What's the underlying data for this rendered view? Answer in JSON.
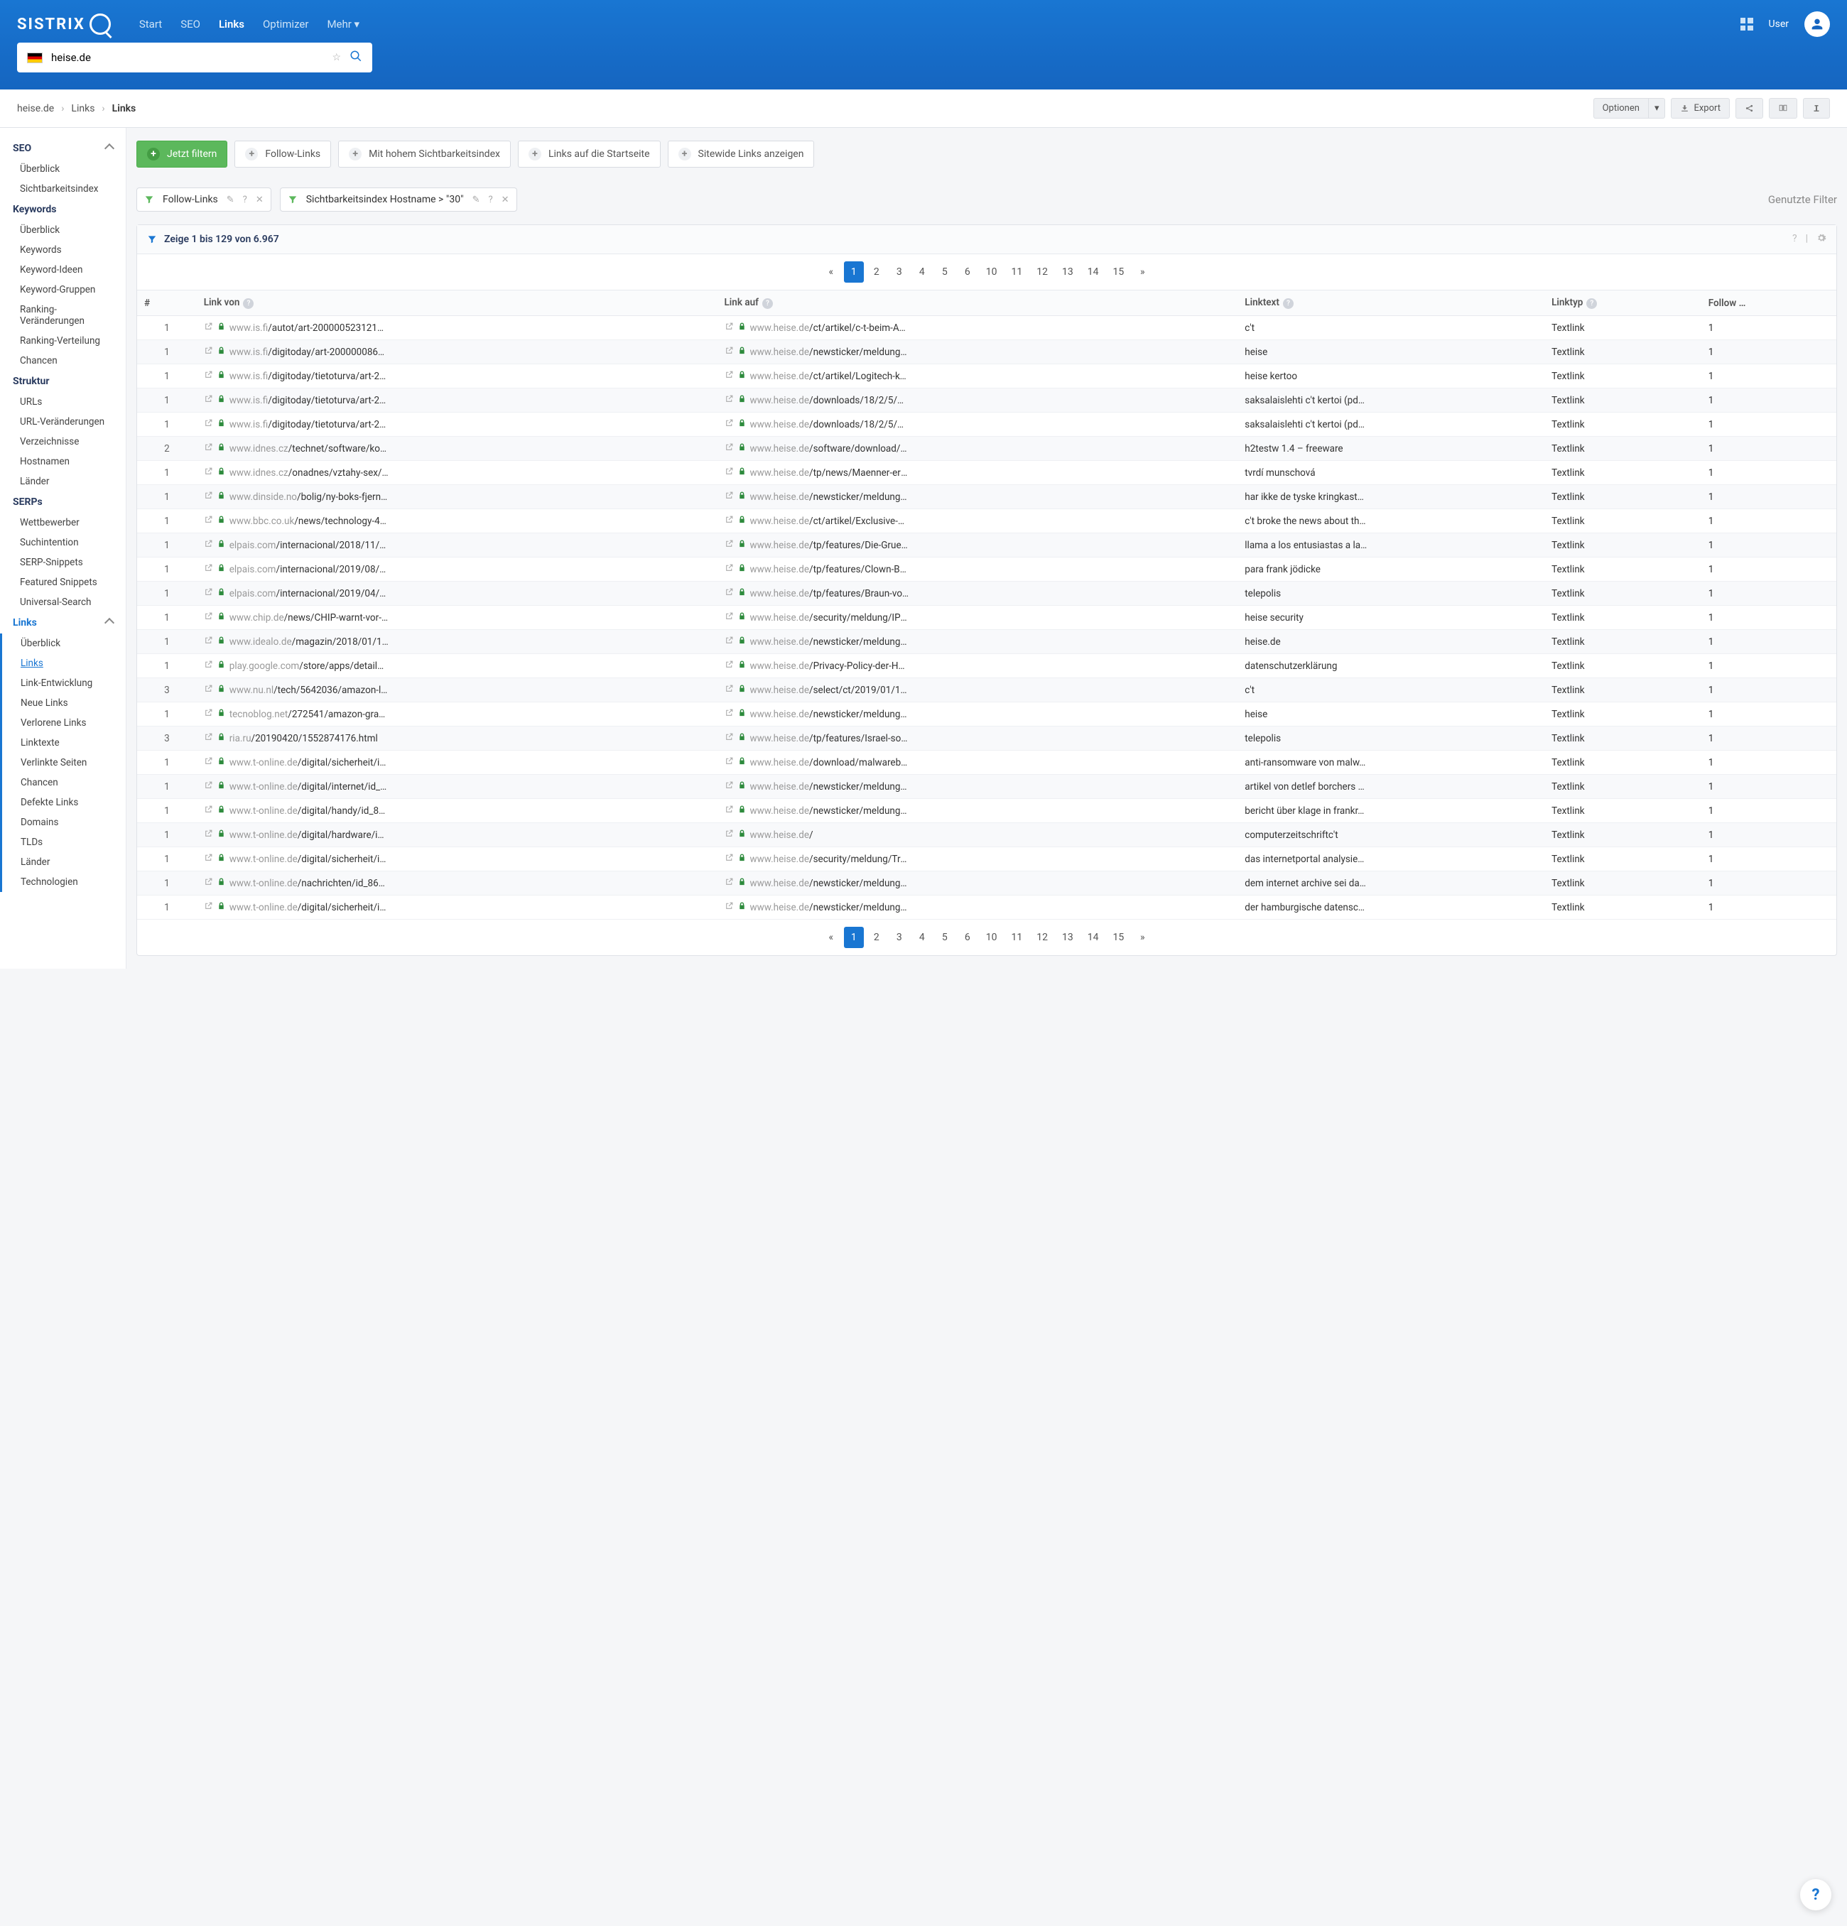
{
  "nav": {
    "brand": "SISTRIX",
    "links": [
      {
        "t": "Start"
      },
      {
        "t": "SEO"
      },
      {
        "t": "Links",
        "active": true
      },
      {
        "t": "Optimizer"
      },
      {
        "t": "Mehr ▾"
      }
    ],
    "user": "User"
  },
  "search": {
    "value": "heise.de"
  },
  "crumbs": [
    "heise.de",
    "Links",
    "Links"
  ],
  "toolbar": {
    "optionen": "Optionen",
    "export": "Export"
  },
  "side": {
    "seo": {
      "h": "SEO",
      "items": [
        "Überblick",
        "Sichtbarkeitsindex"
      ]
    },
    "keywords": {
      "h": "Keywords",
      "items": [
        "Überblick",
        "Keywords",
        "Keyword-Ideen",
        "Keyword-Gruppen",
        "Ranking-Veränderungen",
        "Ranking-Verteilung",
        "Chancen"
      ]
    },
    "struktur": {
      "h": "Struktur",
      "items": [
        "URLs",
        "URL-Veränderungen",
        "Verzeichnisse",
        "Hostnamen",
        "Länder"
      ]
    },
    "serps": {
      "h": "SERPs",
      "items": [
        "Wettbewerber",
        "Suchintention",
        "SERP-Snippets",
        "Featured Snippets",
        "Universal-Search"
      ]
    },
    "links": {
      "h": "Links",
      "items": [
        "Überblick",
        "Links",
        "Link-Entwicklung",
        "Neue Links",
        "Verlorene Links",
        "Linktexte",
        "Verlinkte Seiten",
        "Chancen",
        "Defekte Links",
        "Domains",
        "TLDs",
        "Länder",
        "Technologien"
      ],
      "active": 1
    }
  },
  "filters": {
    "btns": [
      {
        "t": "Jetzt filtern",
        "green": true
      },
      {
        "t": "Follow-Links"
      },
      {
        "t": "Mit hohem Sichtbarkeitsindex"
      },
      {
        "t": "Links auf die Startseite"
      },
      {
        "t": "Sitewide Links anzeigen"
      }
    ],
    "chips": [
      {
        "t": "Follow-Links"
      },
      {
        "t": "Sichtbarkeitsindex Hostname > \"30\""
      }
    ],
    "used": "Genutzte Filter"
  },
  "table": {
    "summary": "Zeige 1 bis 129 von 6.967",
    "pages": [
      "1",
      "2",
      "3",
      "4",
      "5",
      "6",
      "10",
      "11",
      "12",
      "13",
      "14",
      "15"
    ],
    "cols": {
      "num": "#",
      "from": "Link von",
      "to": "Link auf",
      "txt": "Linktext",
      "typ": "Linktyp",
      "fol": "Follow …"
    },
    "rows": [
      {
        "n": "1",
        "fh": "www.is.fi",
        "fp": "/autot/art-2000005231213.htm…",
        "th": "www.heise.de",
        "tp": "/ct/artikel/c-t-beim-ADAC-…",
        "lt": "c't",
        "ty": "Textlink",
        "fo": "1"
      },
      {
        "n": "1",
        "fh": "www.is.fi",
        "fp": "/digitoday/art-2000000865426.…",
        "th": "www.heise.de",
        "tp": "/newsticker/meldung/1800-M…",
        "lt": "heise",
        "ty": "Textlink",
        "fo": "1"
      },
      {
        "n": "1",
        "fh": "www.is.fi",
        "fp": "/digitoday/tietoturva/art-20000…",
        "th": "www.heise.de",
        "tp": "/ct/artikel/Logitech-keybo…",
        "lt": "heise kertoo",
        "ty": "Textlink",
        "fo": "1"
      },
      {
        "n": "1",
        "fh": "www.is.fi",
        "fp": "/digitoday/tietoturva/art-20000…",
        "th": "www.heise.de",
        "tp": "/downloads/18/2/5/6/5/3…",
        "lt": "saksalaislehti c't kertoi (pd…",
        "ty": "Textlink",
        "fo": "1"
      },
      {
        "n": "1",
        "fh": "www.is.fi",
        "fp": "/digitoday/tietoturva/art-20000…",
        "th": "www.heise.de",
        "tp": "/downloads/18/2/5/6/5/3…",
        "lt": "saksalaislehti c't kertoi (pd…",
        "ty": "Textlink",
        "fo": "1"
      },
      {
        "n": "2",
        "fh": "www.idnes.cz",
        "fp": "/technet/software/kontrol…",
        "th": "www.heise.de",
        "tp": "/software/download/h2testw…",
        "lt": "h2testw 1.4 – freeware",
        "ty": "Textlink",
        "fo": "1"
      },
      {
        "n": "1",
        "fh": "www.idnes.cz",
        "fp": "/onadnes/vztahy-sex/spol…",
        "th": "www.heise.de",
        "tp": "/tp/news/Maenner-ertrage…",
        "lt": "tvrdí munschová",
        "ty": "Textlink",
        "fo": "1"
      },
      {
        "n": "1",
        "fh": "www.dinside.no",
        "fp": "/bolig/ny-boks-fjerner-tv-…",
        "th": "www.heise.de",
        "tp": "/newsticker/meldung/Adbloc…",
        "lt": "har ikke de tyske kringkast…",
        "ty": "Textlink",
        "fo": "1"
      },
      {
        "n": "1",
        "fh": "www.bbc.co.uk",
        "fp": "/news/technology-44003…",
        "th": "www.heise.de",
        "tp": "/ct/artikel/Exclusive-Spect…",
        "lt": "c't broke the news about th…",
        "ty": "Textlink",
        "fo": "1"
      },
      {
        "n": "1",
        "fh": "elpais.com",
        "fp": "/internacional/2018/11/30/a…",
        "th": "www.heise.de",
        "tp": "/tp/features/Die-Gruenen-…",
        "lt": "llama a los entusiastas a la…",
        "ty": "Textlink",
        "fo": "1"
      },
      {
        "n": "1",
        "fh": "elpais.com",
        "fp": "/internacional/2019/08/02/a…",
        "th": "www.heise.de",
        "tp": "/tp/features/Clown-BoJo-…",
        "lt": "para frank jödicke",
        "ty": "Textlink",
        "fo": "1"
      },
      {
        "n": "1",
        "fh": "elpais.com",
        "fp": "/internacional/2019/04/04/a…",
        "th": "www.heise.de",
        "tp": "/tp/features/Braun-von-KS…",
        "lt": "telepolis",
        "ty": "Textlink",
        "fo": "1"
      },
      {
        "n": "1",
        "fh": "www.chip.de",
        "fp": "/news/CHIP-warnt-vor-gefa…",
        "th": "www.heise.de",
        "tp": "/security/meldung/IP-Kamera…",
        "lt": "heise security",
        "ty": "Textlink",
        "fo": "1"
      },
      {
        "n": "1",
        "fh": "www.idealo.de",
        "fp": "/magazin/2018/01/12/ces-2…",
        "th": "www.heise.de",
        "tp": "/newsticker/meldung/Zahlen-…",
        "lt": "heise.de",
        "ty": "Textlink",
        "fo": "1"
      },
      {
        "n": "1",
        "fh": "play.google.com",
        "fp": "/store/apps/details?id=…",
        "th": "www.heise.de",
        "tp": "/Privacy-Policy-der-Heise-Me…",
        "lt": "datenschutzerklärung",
        "ty": "Textlink",
        "fo": "1"
      },
      {
        "n": "3",
        "fh": "www.nu.nl",
        "fp": "/tech/5642036/amazon-liet-gebr…",
        "th": "www.heise.de",
        "tp": "/select/ct/2019/01/1546323…",
        "lt": "c't",
        "ty": "Textlink",
        "fo": "1"
      },
      {
        "n": "1",
        "fh": "tecnoblog.net",
        "fp": "/272541/amazon-gravaco…",
        "th": "www.heise.de",
        "tp": "/newsticker/meldung/Am…",
        "lt": "heise",
        "ty": "Textlink",
        "fo": "1"
      },
      {
        "n": "3",
        "fh": "ria.ru",
        "fp": "/20190420/1552874176.html",
        "th": "www.heise.de",
        "tp": "/tp/features/Israel-soll-ne…",
        "lt": "telepolis",
        "ty": "Textlink",
        "fo": "1"
      },
      {
        "n": "1",
        "fh": "www.t-online.de",
        "fp": "/digital/sicherheit/id_78…",
        "th": "www.heise.de",
        "tp": "/download/malwarebytes-ant…",
        "lt": "anti-ransomware von malw…",
        "ty": "Textlink",
        "fo": "1"
      },
      {
        "n": "1",
        "fh": "www.t-online.de",
        "fp": "/digital/internet/id_8334…",
        "th": "www.heise.de",
        "tp": "/newsticker/meldung/Mis…",
        "lt": "artikel von detlef borchers …",
        "ty": "Textlink",
        "fo": "1"
      },
      {
        "n": "1",
        "fh": "www.t-online.de",
        "fp": "/digital/handy/id_82967…",
        "th": "www.heise.de",
        "tp": "/newsticker/meldung/Klag…",
        "lt": "bericht über klage in frankr…",
        "ty": "Textlink",
        "fo": "1"
      },
      {
        "n": "1",
        "fh": "www.t-online.de",
        "fp": "/digital/hardware/id_81600…",
        "th": "www.heise.de",
        "tp": "/",
        "lt": "computerzeitschriftc't",
        "ty": "Textlink",
        "fo": "1"
      },
      {
        "n": "1",
        "fh": "www.t-online.de",
        "fp": "/digital/sicherheit/id_84…",
        "th": "www.heise.de",
        "tp": "/security/meldung/Trojan…",
        "lt": "das internetportal analysie…",
        "ty": "Textlink",
        "fo": "1"
      },
      {
        "n": "1",
        "fh": "www.t-online.de",
        "fp": "/nachrichten/id_866204…",
        "th": "www.heise.de",
        "tp": "/newsticker/meldung/MS-…",
        "lt": "dem internet archive sei da…",
        "ty": "Textlink",
        "fo": "1"
      },
      {
        "n": "1",
        "fh": "www.t-online.de",
        "fp": "/digital/sicherheit/id_87…",
        "th": "www.heise.de",
        "tp": "/newsticker/meldung/Mas…",
        "lt": "der hamburgische datensc…",
        "ty": "Textlink",
        "fo": "1"
      }
    ]
  }
}
